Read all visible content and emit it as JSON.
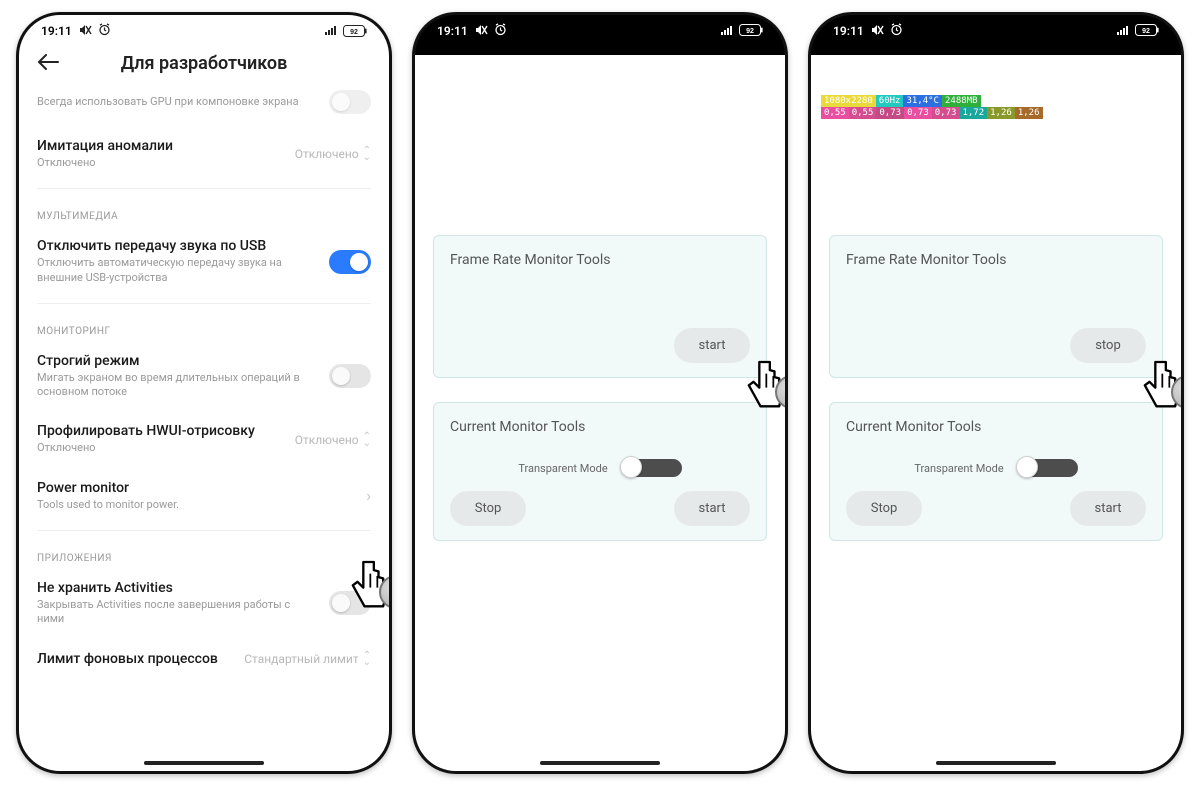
{
  "status": {
    "time": "19:11",
    "battery": "92"
  },
  "phone1": {
    "header_title": "Для разработчиков",
    "truncated_row": {
      "title": "Всегда использовать GPU при компоновке экрана"
    },
    "anomaly": {
      "title": "Имитация аномалии",
      "sub": "Отключено",
      "value": "Отключено"
    },
    "section_media": "МУЛЬТИМЕДИА",
    "usb_audio": {
      "title": "Отключить передачу звука по USB",
      "sub": "Отключить автоматическую передачу звука на внешние USB-устройства"
    },
    "section_monitor": "МОНИТОРИНГ",
    "strict": {
      "title": "Строгий режим",
      "sub": "Мигать экраном во время длительных операций в основном потоке"
    },
    "hwui": {
      "title": "Профилировать HWUI-отрисовку",
      "sub": "Отключено",
      "value": "Отключено"
    },
    "power": {
      "title": "Power monitor",
      "sub": "Tools used to monitor power."
    },
    "section_apps": "ПРИЛОЖЕНИЯ",
    "activities": {
      "title": "Не хранить Activities",
      "sub": "Закрывать Activities после завершения работы с ними"
    },
    "bg_limit": {
      "title": "Лимит фоновых процессов",
      "value": "Стандартный лимит"
    }
  },
  "phone2": {
    "card1_title": "Frame Rate Monitor Tools",
    "card1_button": "start",
    "card2_title": "Current Monitor Tools",
    "transparent_label": "Transparent Mode",
    "card2_stop": "Stop",
    "card2_start": "start"
  },
  "phone3": {
    "card1_title": "Frame Rate Monitor Tools",
    "card1_button": "stop",
    "card2_title": "Current Monitor Tools",
    "transparent_label": "Transparent Mode",
    "card2_stop": "Stop",
    "card2_start": "start",
    "overlay_line1": {
      "res": "1080x2280",
      "hz": "60Hz",
      "temp": "31,4°C",
      "mem": "2488MB"
    },
    "overlay_line2": {
      "a": "0,55",
      "b": "0,55",
      "c": "0,73",
      "d": "0,73",
      "e": "0,73",
      "f": "1,72",
      "g": "1,26",
      "h": "1,26"
    }
  }
}
